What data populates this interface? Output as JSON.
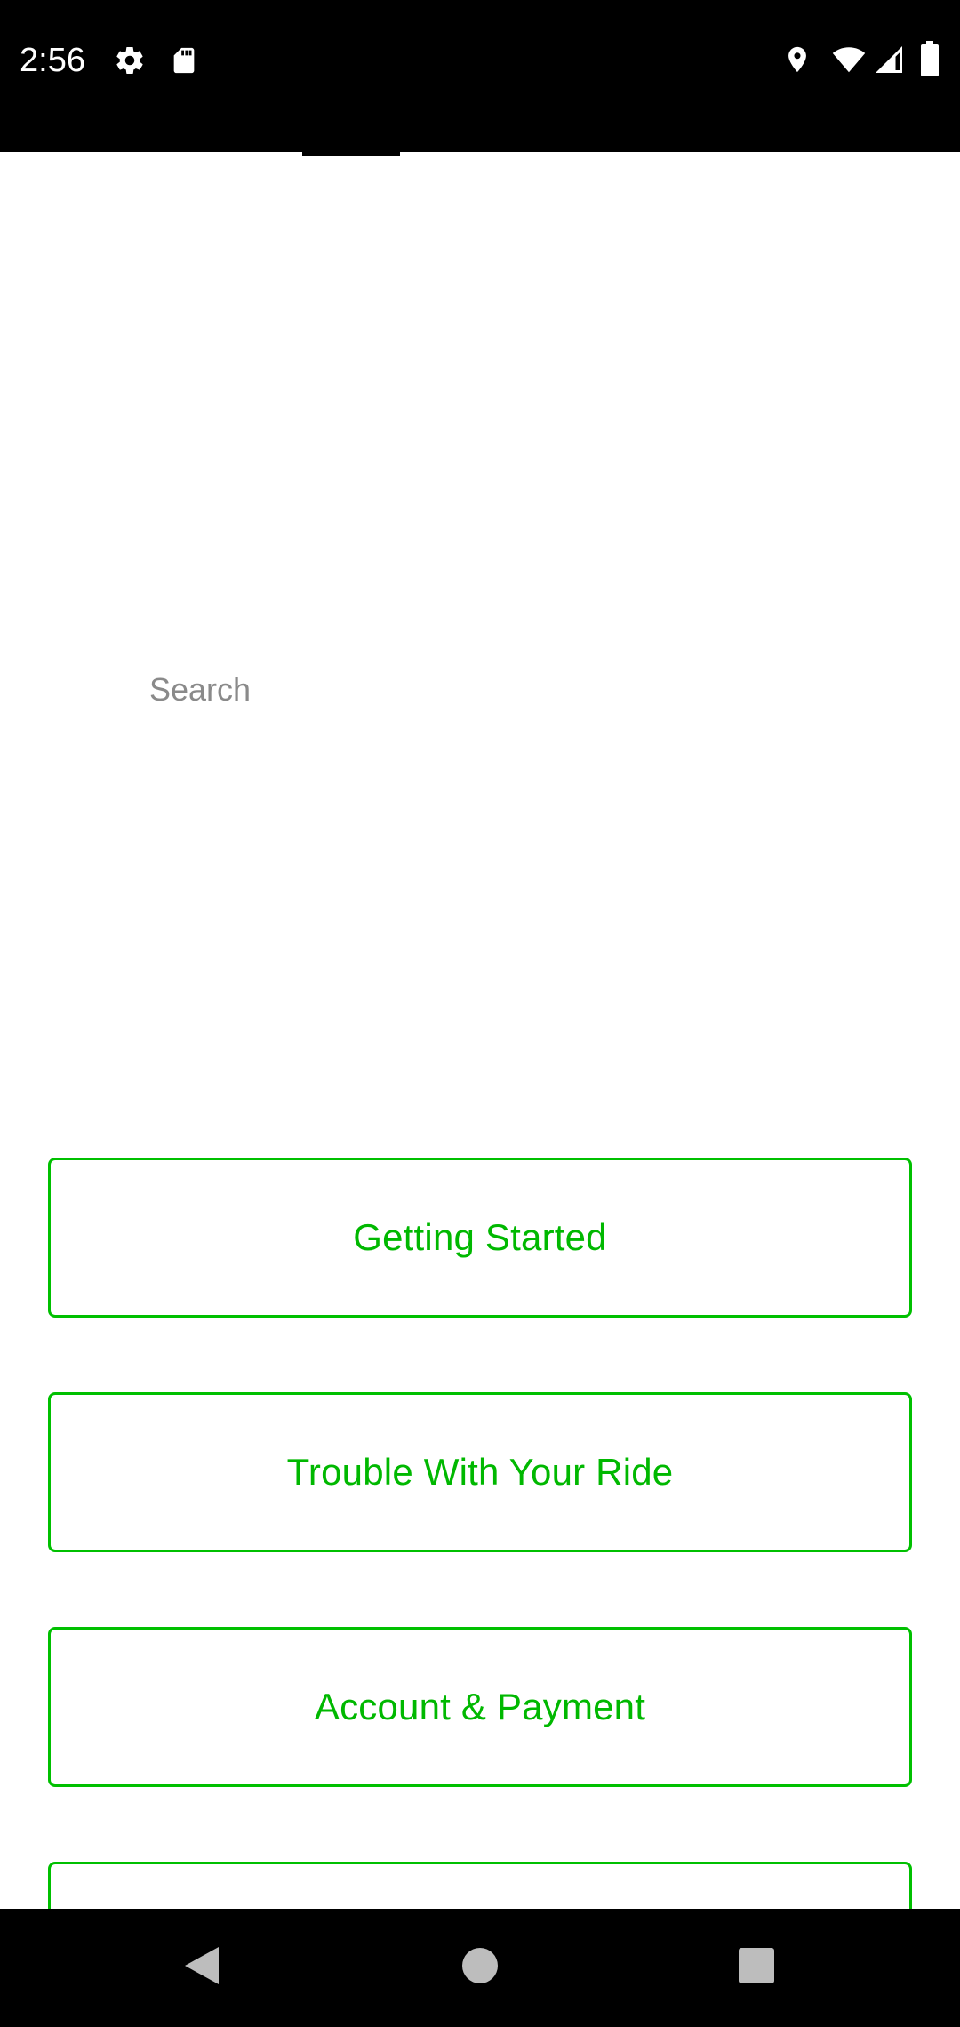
{
  "status_bar": {
    "time": "2:56",
    "left_icons": [
      "gear-icon",
      "sd-card-icon"
    ],
    "right_icons": [
      "location-icon",
      "wifi-icon",
      "cell-signal-icon",
      "battery-icon"
    ]
  },
  "search": {
    "placeholder": "Search",
    "value": ""
  },
  "categories": [
    {
      "label": "Getting Started"
    },
    {
      "label": "Trouble With Your Ride"
    },
    {
      "label": "Account & Payment"
    },
    {
      "label": ""
    }
  ],
  "nav_bar": {
    "buttons": [
      "back-icon",
      "home-icon",
      "recents-icon"
    ]
  },
  "colors": {
    "accent": "#00c000",
    "status_bar_bg": "#000000",
    "nav_bar_bg": "#000000",
    "placeholder": "#8a8a8a"
  }
}
